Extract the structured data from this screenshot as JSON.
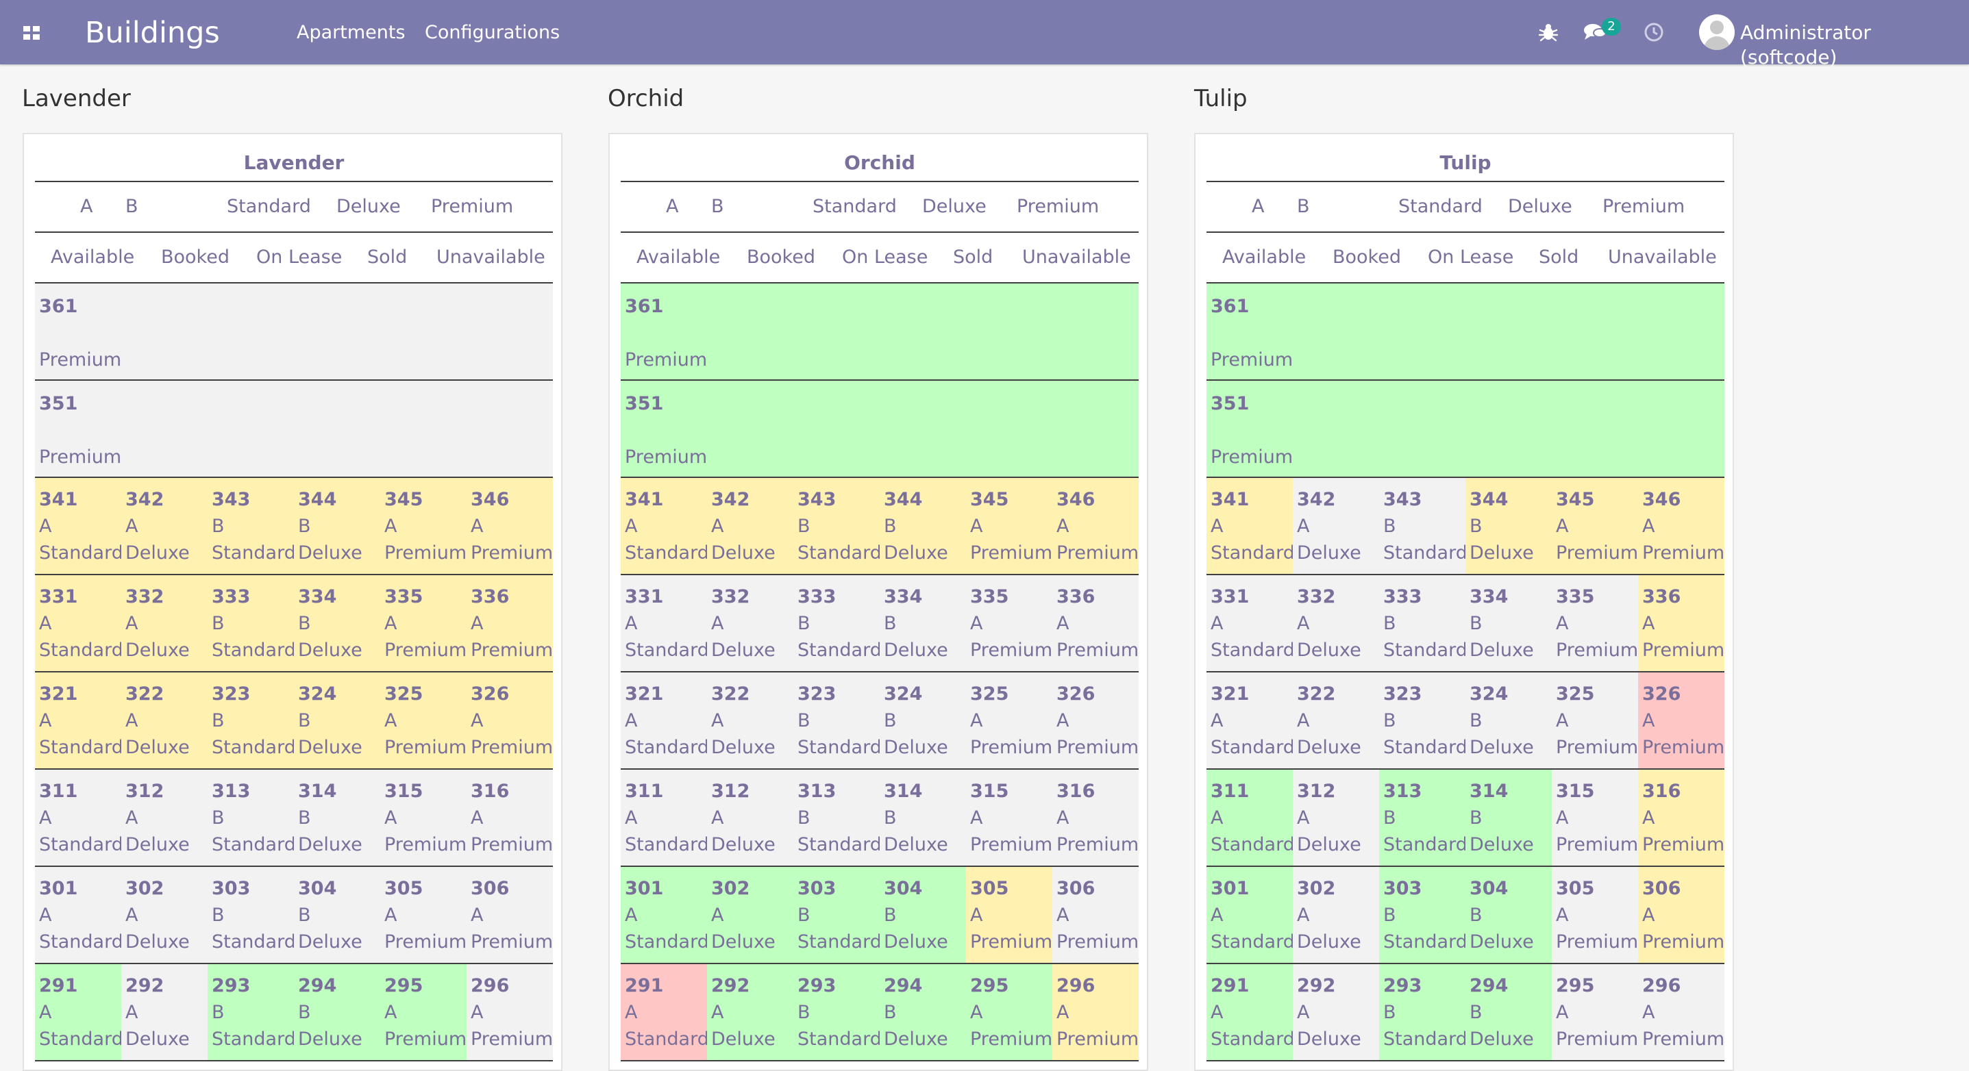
{
  "app": {
    "title": "Buildings",
    "menu": [
      "Apartments",
      "Configurations"
    ],
    "message_count": "2",
    "user": "Administrator (softcode)"
  },
  "colors": {
    "navbar": "#7c7bad",
    "text": "#7a6f9a",
    "unavailable": "#f2f2f2",
    "available": "#bfffbf",
    "booked": "#fff2b0",
    "on_lease": "#ffc6c6"
  },
  "legend": {
    "blocks": [
      "A",
      "B"
    ],
    "types": [
      "Standard",
      "Deluxe",
      "Premium"
    ],
    "statuses": [
      "Available",
      "Booked",
      "On Lease",
      "Sold",
      "Unavailable"
    ]
  },
  "buildings": [
    {
      "name": "Lavender",
      "full_rows": [
        {
          "number": "361",
          "type": "Premium",
          "status": "Unavailable"
        },
        {
          "number": "351",
          "type": "Premium",
          "status": "Unavailable"
        }
      ],
      "floors": [
        {
          "units": [
            {
              "number": "341",
              "block": "A",
              "type": "Standard",
              "status": "Booked"
            },
            {
              "number": "342",
              "block": "A",
              "type": "Deluxe",
              "status": "Booked"
            },
            {
              "number": "343",
              "block": "B",
              "type": "Standard",
              "status": "Booked"
            },
            {
              "number": "344",
              "block": "B",
              "type": "Deluxe",
              "status": "Booked"
            },
            {
              "number": "345",
              "block": "A",
              "type": "Premium",
              "status": "Booked"
            },
            {
              "number": "346",
              "block": "A",
              "type": "Premium",
              "status": "Booked"
            }
          ]
        },
        {
          "units": [
            {
              "number": "331",
              "block": "A",
              "type": "Standard",
              "status": "Booked"
            },
            {
              "number": "332",
              "block": "A",
              "type": "Deluxe",
              "status": "Booked"
            },
            {
              "number": "333",
              "block": "B",
              "type": "Standard",
              "status": "Booked"
            },
            {
              "number": "334",
              "block": "B",
              "type": "Deluxe",
              "status": "Booked"
            },
            {
              "number": "335",
              "block": "A",
              "type": "Premium",
              "status": "Booked"
            },
            {
              "number": "336",
              "block": "A",
              "type": "Premium",
              "status": "Booked"
            }
          ]
        },
        {
          "units": [
            {
              "number": "321",
              "block": "A",
              "type": "Standard",
              "status": "Booked"
            },
            {
              "number": "322",
              "block": "A",
              "type": "Deluxe",
              "status": "Booked"
            },
            {
              "number": "323",
              "block": "B",
              "type": "Standard",
              "status": "Booked"
            },
            {
              "number": "324",
              "block": "B",
              "type": "Deluxe",
              "status": "Booked"
            },
            {
              "number": "325",
              "block": "A",
              "type": "Premium",
              "status": "Booked"
            },
            {
              "number": "326",
              "block": "A",
              "type": "Premium",
              "status": "Booked"
            }
          ]
        },
        {
          "units": [
            {
              "number": "311",
              "block": "A",
              "type": "Standard",
              "status": "Unavailable"
            },
            {
              "number": "312",
              "block": "A",
              "type": "Deluxe",
              "status": "Unavailable"
            },
            {
              "number": "313",
              "block": "B",
              "type": "Standard",
              "status": "Unavailable"
            },
            {
              "number": "314",
              "block": "B",
              "type": "Deluxe",
              "status": "Unavailable"
            },
            {
              "number": "315",
              "block": "A",
              "type": "Premium",
              "status": "Unavailable"
            },
            {
              "number": "316",
              "block": "A",
              "type": "Premium",
              "status": "Unavailable"
            }
          ]
        },
        {
          "units": [
            {
              "number": "301",
              "block": "A",
              "type": "Standard",
              "status": "Unavailable"
            },
            {
              "number": "302",
              "block": "A",
              "type": "Deluxe",
              "status": "Unavailable"
            },
            {
              "number": "303",
              "block": "B",
              "type": "Standard",
              "status": "Unavailable"
            },
            {
              "number": "304",
              "block": "B",
              "type": "Deluxe",
              "status": "Unavailable"
            },
            {
              "number": "305",
              "block": "A",
              "type": "Premium",
              "status": "Unavailable"
            },
            {
              "number": "306",
              "block": "A",
              "type": "Premium",
              "status": "Unavailable"
            }
          ]
        },
        {
          "units": [
            {
              "number": "291",
              "block": "A",
              "type": "Standard",
              "status": "Available"
            },
            {
              "number": "292",
              "block": "A",
              "type": "Deluxe",
              "status": "Unavailable"
            },
            {
              "number": "293",
              "block": "B",
              "type": "Standard",
              "status": "Available"
            },
            {
              "number": "294",
              "block": "B",
              "type": "Deluxe",
              "status": "Available"
            },
            {
              "number": "295",
              "block": "A",
              "type": "Premium",
              "status": "Available"
            },
            {
              "number": "296",
              "block": "A",
              "type": "Premium",
              "status": "Unavailable"
            }
          ]
        }
      ]
    },
    {
      "name": "Orchid",
      "full_rows": [
        {
          "number": "361",
          "type": "Premium",
          "status": "Available"
        },
        {
          "number": "351",
          "type": "Premium",
          "status": "Available"
        }
      ],
      "floors": [
        {
          "units": [
            {
              "number": "341",
              "block": "A",
              "type": "Standard",
              "status": "Booked"
            },
            {
              "number": "342",
              "block": "A",
              "type": "Deluxe",
              "status": "Booked"
            },
            {
              "number": "343",
              "block": "B",
              "type": "Standard",
              "status": "Booked"
            },
            {
              "number": "344",
              "block": "B",
              "type": "Deluxe",
              "status": "Booked"
            },
            {
              "number": "345",
              "block": "A",
              "type": "Premium",
              "status": "Booked"
            },
            {
              "number": "346",
              "block": "A",
              "type": "Premium",
              "status": "Booked"
            }
          ]
        },
        {
          "units": [
            {
              "number": "331",
              "block": "A",
              "type": "Standard",
              "status": "Unavailable"
            },
            {
              "number": "332",
              "block": "A",
              "type": "Deluxe",
              "status": "Unavailable"
            },
            {
              "number": "333",
              "block": "B",
              "type": "Standard",
              "status": "Unavailable"
            },
            {
              "number": "334",
              "block": "B",
              "type": "Deluxe",
              "status": "Unavailable"
            },
            {
              "number": "335",
              "block": "A",
              "type": "Premium",
              "status": "Unavailable"
            },
            {
              "number": "336",
              "block": "A",
              "type": "Premium",
              "status": "Unavailable"
            }
          ]
        },
        {
          "units": [
            {
              "number": "321",
              "block": "A",
              "type": "Standard",
              "status": "Unavailable"
            },
            {
              "number": "322",
              "block": "A",
              "type": "Deluxe",
              "status": "Unavailable"
            },
            {
              "number": "323",
              "block": "B",
              "type": "Standard",
              "status": "Unavailable"
            },
            {
              "number": "324",
              "block": "B",
              "type": "Deluxe",
              "status": "Unavailable"
            },
            {
              "number": "325",
              "block": "A",
              "type": "Premium",
              "status": "Unavailable"
            },
            {
              "number": "326",
              "block": "A",
              "type": "Premium",
              "status": "Unavailable"
            }
          ]
        },
        {
          "units": [
            {
              "number": "311",
              "block": "A",
              "type": "Standard",
              "status": "Unavailable"
            },
            {
              "number": "312",
              "block": "A",
              "type": "Deluxe",
              "status": "Unavailable"
            },
            {
              "number": "313",
              "block": "B",
              "type": "Standard",
              "status": "Unavailable"
            },
            {
              "number": "314",
              "block": "B",
              "type": "Deluxe",
              "status": "Unavailable"
            },
            {
              "number": "315",
              "block": "A",
              "type": "Premium",
              "status": "Unavailable"
            },
            {
              "number": "316",
              "block": "A",
              "type": "Premium",
              "status": "Unavailable"
            }
          ]
        },
        {
          "units": [
            {
              "number": "301",
              "block": "A",
              "type": "Standard",
              "status": "Available"
            },
            {
              "number": "302",
              "block": "A",
              "type": "Deluxe",
              "status": "Available"
            },
            {
              "number": "303",
              "block": "B",
              "type": "Standard",
              "status": "Available"
            },
            {
              "number": "304",
              "block": "B",
              "type": "Deluxe",
              "status": "Available"
            },
            {
              "number": "305",
              "block": "A",
              "type": "Premium",
              "status": "Booked"
            },
            {
              "number": "306",
              "block": "A",
              "type": "Premium",
              "status": "Unavailable"
            }
          ]
        },
        {
          "units": [
            {
              "number": "291",
              "block": "A",
              "type": "Standard",
              "status": "On Lease"
            },
            {
              "number": "292",
              "block": "A",
              "type": "Deluxe",
              "status": "Available"
            },
            {
              "number": "293",
              "block": "B",
              "type": "Standard",
              "status": "Available"
            },
            {
              "number": "294",
              "block": "B",
              "type": "Deluxe",
              "status": "Available"
            },
            {
              "number": "295",
              "block": "A",
              "type": "Premium",
              "status": "Available"
            },
            {
              "number": "296",
              "block": "A",
              "type": "Premium",
              "status": "Booked"
            }
          ]
        }
      ]
    },
    {
      "name": "Tulip",
      "full_rows": [
        {
          "number": "361",
          "type": "Premium",
          "status": "Available"
        },
        {
          "number": "351",
          "type": "Premium",
          "status": "Available"
        }
      ],
      "floors": [
        {
          "units": [
            {
              "number": "341",
              "block": "A",
              "type": "Standard",
              "status": "Booked"
            },
            {
              "number": "342",
              "block": "A",
              "type": "Deluxe",
              "status": "Unavailable"
            },
            {
              "number": "343",
              "block": "B",
              "type": "Standard",
              "status": "Unavailable"
            },
            {
              "number": "344",
              "block": "B",
              "type": "Deluxe",
              "status": "Booked"
            },
            {
              "number": "345",
              "block": "A",
              "type": "Premium",
              "status": "Booked"
            },
            {
              "number": "346",
              "block": "A",
              "type": "Premium",
              "status": "Booked"
            }
          ]
        },
        {
          "units": [
            {
              "number": "331",
              "block": "A",
              "type": "Standard",
              "status": "Unavailable"
            },
            {
              "number": "332",
              "block": "A",
              "type": "Deluxe",
              "status": "Unavailable"
            },
            {
              "number": "333",
              "block": "B",
              "type": "Standard",
              "status": "Unavailable"
            },
            {
              "number": "334",
              "block": "B",
              "type": "Deluxe",
              "status": "Unavailable"
            },
            {
              "number": "335",
              "block": "A",
              "type": "Premium",
              "status": "Unavailable"
            },
            {
              "number": "336",
              "block": "A",
              "type": "Premium",
              "status": "Booked"
            }
          ]
        },
        {
          "units": [
            {
              "number": "321",
              "block": "A",
              "type": "Standard",
              "status": "Unavailable"
            },
            {
              "number": "322",
              "block": "A",
              "type": "Deluxe",
              "status": "Unavailable"
            },
            {
              "number": "323",
              "block": "B",
              "type": "Standard",
              "status": "Unavailable"
            },
            {
              "number": "324",
              "block": "B",
              "type": "Deluxe",
              "status": "Unavailable"
            },
            {
              "number": "325",
              "block": "A",
              "type": "Premium",
              "status": "Unavailable"
            },
            {
              "number": "326",
              "block": "A",
              "type": "Premium",
              "status": "On Lease"
            }
          ]
        },
        {
          "units": [
            {
              "number": "311",
              "block": "A",
              "type": "Standard",
              "status": "Available"
            },
            {
              "number": "312",
              "block": "A",
              "type": "Deluxe",
              "status": "Unavailable"
            },
            {
              "number": "313",
              "block": "B",
              "type": "Standard",
              "status": "Available"
            },
            {
              "number": "314",
              "block": "B",
              "type": "Deluxe",
              "status": "Available"
            },
            {
              "number": "315",
              "block": "A",
              "type": "Premium",
              "status": "Unavailable"
            },
            {
              "number": "316",
              "block": "A",
              "type": "Premium",
              "status": "Booked"
            }
          ]
        },
        {
          "units": [
            {
              "number": "301",
              "block": "A",
              "type": "Standard",
              "status": "Available"
            },
            {
              "number": "302",
              "block": "A",
              "type": "Deluxe",
              "status": "Unavailable"
            },
            {
              "number": "303",
              "block": "B",
              "type": "Standard",
              "status": "Available"
            },
            {
              "number": "304",
              "block": "B",
              "type": "Deluxe",
              "status": "Available"
            },
            {
              "number": "305",
              "block": "A",
              "type": "Premium",
              "status": "Unavailable"
            },
            {
              "number": "306",
              "block": "A",
              "type": "Premium",
              "status": "Booked"
            }
          ]
        },
        {
          "units": [
            {
              "number": "291",
              "block": "A",
              "type": "Standard",
              "status": "Available"
            },
            {
              "number": "292",
              "block": "A",
              "type": "Deluxe",
              "status": "Unavailable"
            },
            {
              "number": "293",
              "block": "B",
              "type": "Standard",
              "status": "Available"
            },
            {
              "number": "294",
              "block": "B",
              "type": "Deluxe",
              "status": "Available"
            },
            {
              "number": "295",
              "block": "A",
              "type": "Premium",
              "status": "Unavailable"
            },
            {
              "number": "296",
              "block": "A",
              "type": "Premium",
              "status": "Unavailable"
            }
          ]
        }
      ]
    }
  ]
}
